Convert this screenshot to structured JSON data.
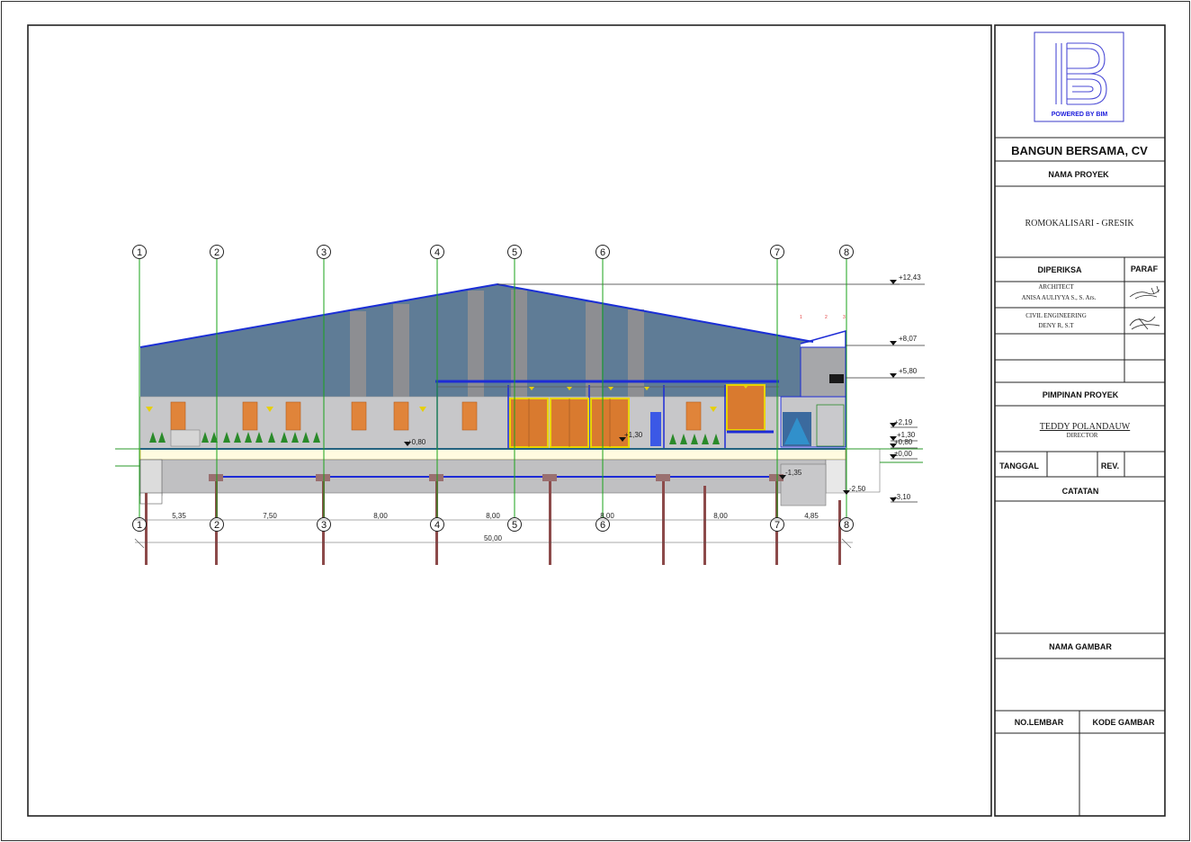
{
  "logo": {
    "caption": "POWERED BY BIM"
  },
  "title_block": {
    "company": "BANGUN BERSAMA, CV",
    "project_label": "NAMA PROYEK",
    "project_name": "ROMOKALISARI - GRESIK",
    "checked_label": "DIPERIKSA",
    "sign_label": "PARAF",
    "architect_role": "ARCHITECT",
    "architect_name": "ANISA AULIYYA S., S. Ars.",
    "civil_role": "CIVIL ENGINEERING",
    "civil_name": "DENY R, S.T",
    "leader_label": "PIMPINAN PROYEK",
    "leader_name": "TEDDY POLANDAUW",
    "leader_role": "DIRECTOR",
    "date_label": "TANGGAL",
    "rev_label": "REV.",
    "notes_label": "CATATAN",
    "drawing_name_label": "NAMA GAMBAR",
    "sheet_no_label": "NO.LEMBAR",
    "drawing_code_label": "KODE GAMBAR"
  },
  "drawing": {
    "grid_labels": [
      "1",
      "2",
      "3",
      "4",
      "5",
      "6",
      "7",
      "8"
    ],
    "levels": [
      "+12,43",
      "+8,07",
      "+5,80",
      "+2,19",
      "+1,30",
      "+0,80",
      "±0,00",
      "-1,35",
      "-2,50",
      "-3,10"
    ],
    "inner_levels": [
      "+0,80",
      "+1,30"
    ],
    "spans": [
      "5,35",
      "7,50",
      "8,00",
      "8,00",
      "8,00",
      "8,00",
      "4,85"
    ],
    "total_length": "50,00",
    "small_marks": [
      "1",
      "2",
      "3"
    ]
  },
  "colors": {
    "roof": "#5f7c96",
    "roof_edge": "#1b2fd6",
    "wall": "#c7c7c9",
    "frame_blue": "#1d2bd6",
    "gridline": "#1aa31a",
    "window": "#e0843a",
    "pile": "#8c4a4a"
  }
}
